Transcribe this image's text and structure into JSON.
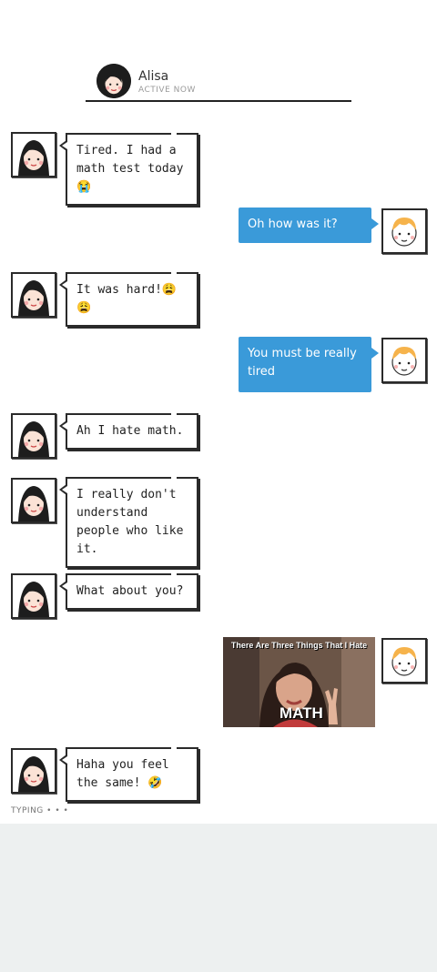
{
  "header": {
    "name": "Alisa",
    "status": "ACTIVE NOW"
  },
  "messages": [
    {
      "from": "Alisa",
      "text": "Tired. I had a math test today 😭"
    },
    {
      "from": "me",
      "text": "Oh how was it?"
    },
    {
      "from": "Alisa",
      "text": "It was hard!😩 😩"
    },
    {
      "from": "me",
      "text": "You must be really tired"
    },
    {
      "from": "Alisa",
      "text": "Ah I hate math."
    },
    {
      "from": "Alisa",
      "text": "I really don't understand people who like it."
    },
    {
      "from": "Alisa",
      "text": "What about you?"
    },
    {
      "from": "me",
      "image": {
        "caption_top": "There Are Three Things That I Hate",
        "caption_bottom": "MATH"
      }
    },
    {
      "from": "Alisa",
      "text": "Haha you feel the same! 🤣"
    }
  ],
  "typing": "TYPING • • •",
  "colors": {
    "outgoing_bubble": "#3a9ad9",
    "bottom_pane": "#edf0f0"
  }
}
